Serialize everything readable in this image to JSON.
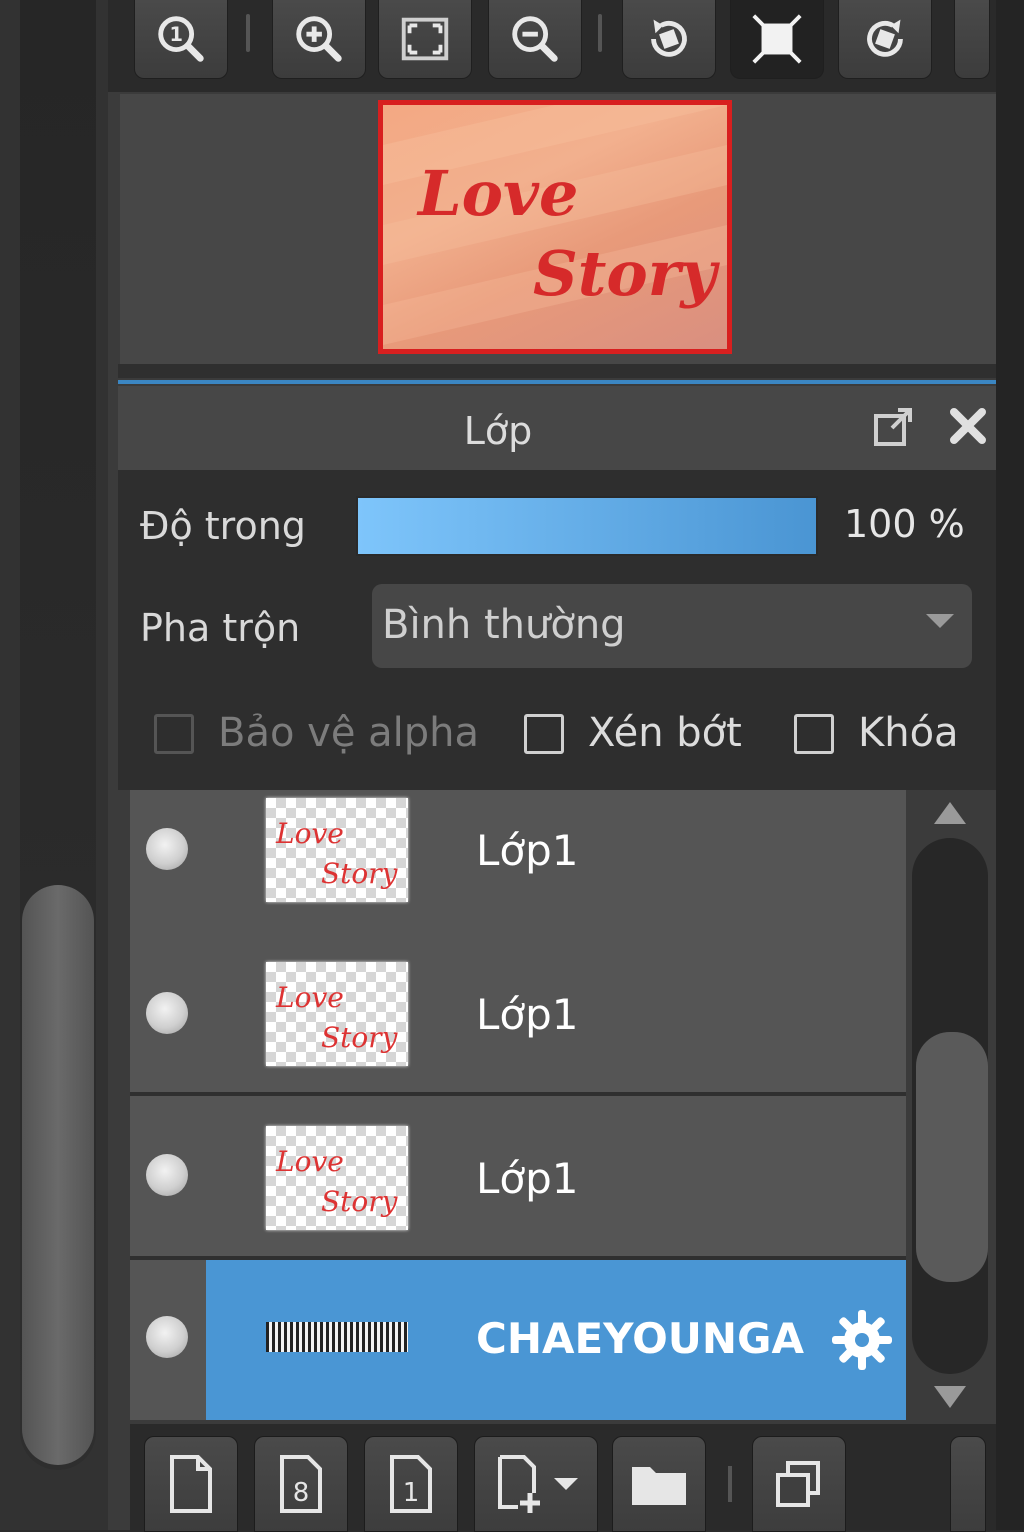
{
  "toolbar": {
    "buttons": [
      "zoom-actual-icon",
      "zoom-in-icon",
      "fit-screen-icon",
      "zoom-out-icon",
      "rotate-left-icon",
      "fullscreen-icon",
      "rotate-right-icon"
    ]
  },
  "navigator": {
    "preview_text_1": "Love",
    "preview_text_2": "Story",
    "frame_color": "#d81f1f"
  },
  "layer_panel": {
    "title": "Lớp",
    "opacity_label": "Độ trong",
    "opacity_value": "100 %",
    "opacity_fraction": 1.0,
    "blend_label": "Pha trộn",
    "blend_value": "Bình thường",
    "protect_alpha_label": "Bảo vệ alpha",
    "clipping_label": "Xén bớt",
    "lock_label": "Khóa"
  },
  "layers": [
    {
      "name": "Lớp1",
      "selected": false
    },
    {
      "name": "Lớp1",
      "selected": false
    },
    {
      "name": "Lớp1",
      "selected": false
    },
    {
      "name": "CHAEYOUNGA",
      "selected": true
    }
  ],
  "colors": {
    "accent": "#4a96d4",
    "opacity_bar_start": "#7ec5fb",
    "opacity_bar_end": "#4a95d3",
    "love_story_red": "#d62a2a"
  },
  "bottom_toolbar": {
    "buttons": [
      "new-layer-icon",
      "new-8bit-layer-icon",
      "new-1bit-layer-icon",
      "add-layer-menu-icon",
      "new-folder-icon",
      "duplicate-layer-icon"
    ]
  }
}
